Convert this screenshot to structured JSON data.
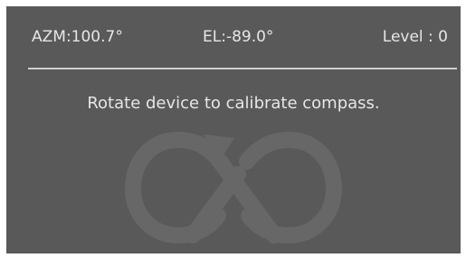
{
  "status": {
    "azimuth": "AZM:100.7°",
    "elevation": "EL:-89.0°",
    "level": "Level : 0"
  },
  "message": "Rotate device to calibrate compass.",
  "icon": "infinity-rotate-icon",
  "colors": {
    "screen_background": "#595959",
    "text": "#e6e6e6",
    "divider": "#cfcfcf",
    "icon": "#676767"
  }
}
